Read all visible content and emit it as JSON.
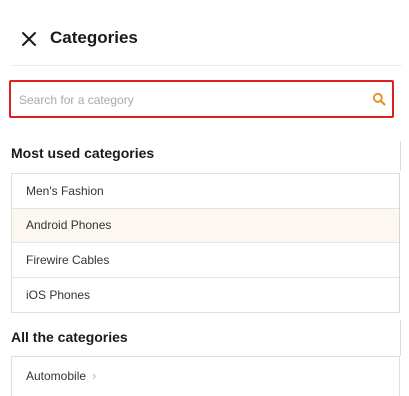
{
  "header": {
    "title": "Categories",
    "close_icon": "close-icon"
  },
  "search": {
    "placeholder": "Search for a category",
    "value": "",
    "icon": "search-icon",
    "accent_color": "#e8891a",
    "border_color": "#e02020"
  },
  "most_used": {
    "title": "Most used categories",
    "items": [
      {
        "label": "Men's Fashion",
        "selected": false
      },
      {
        "label": "Android Phones",
        "selected": true
      },
      {
        "label": "Firewire Cables",
        "selected": false
      },
      {
        "label": "iOS Phones",
        "selected": false
      }
    ]
  },
  "all_categories": {
    "title": "All the categories",
    "items": [
      {
        "label": "Automobile",
        "icon": "chevron-right-icon"
      }
    ]
  }
}
